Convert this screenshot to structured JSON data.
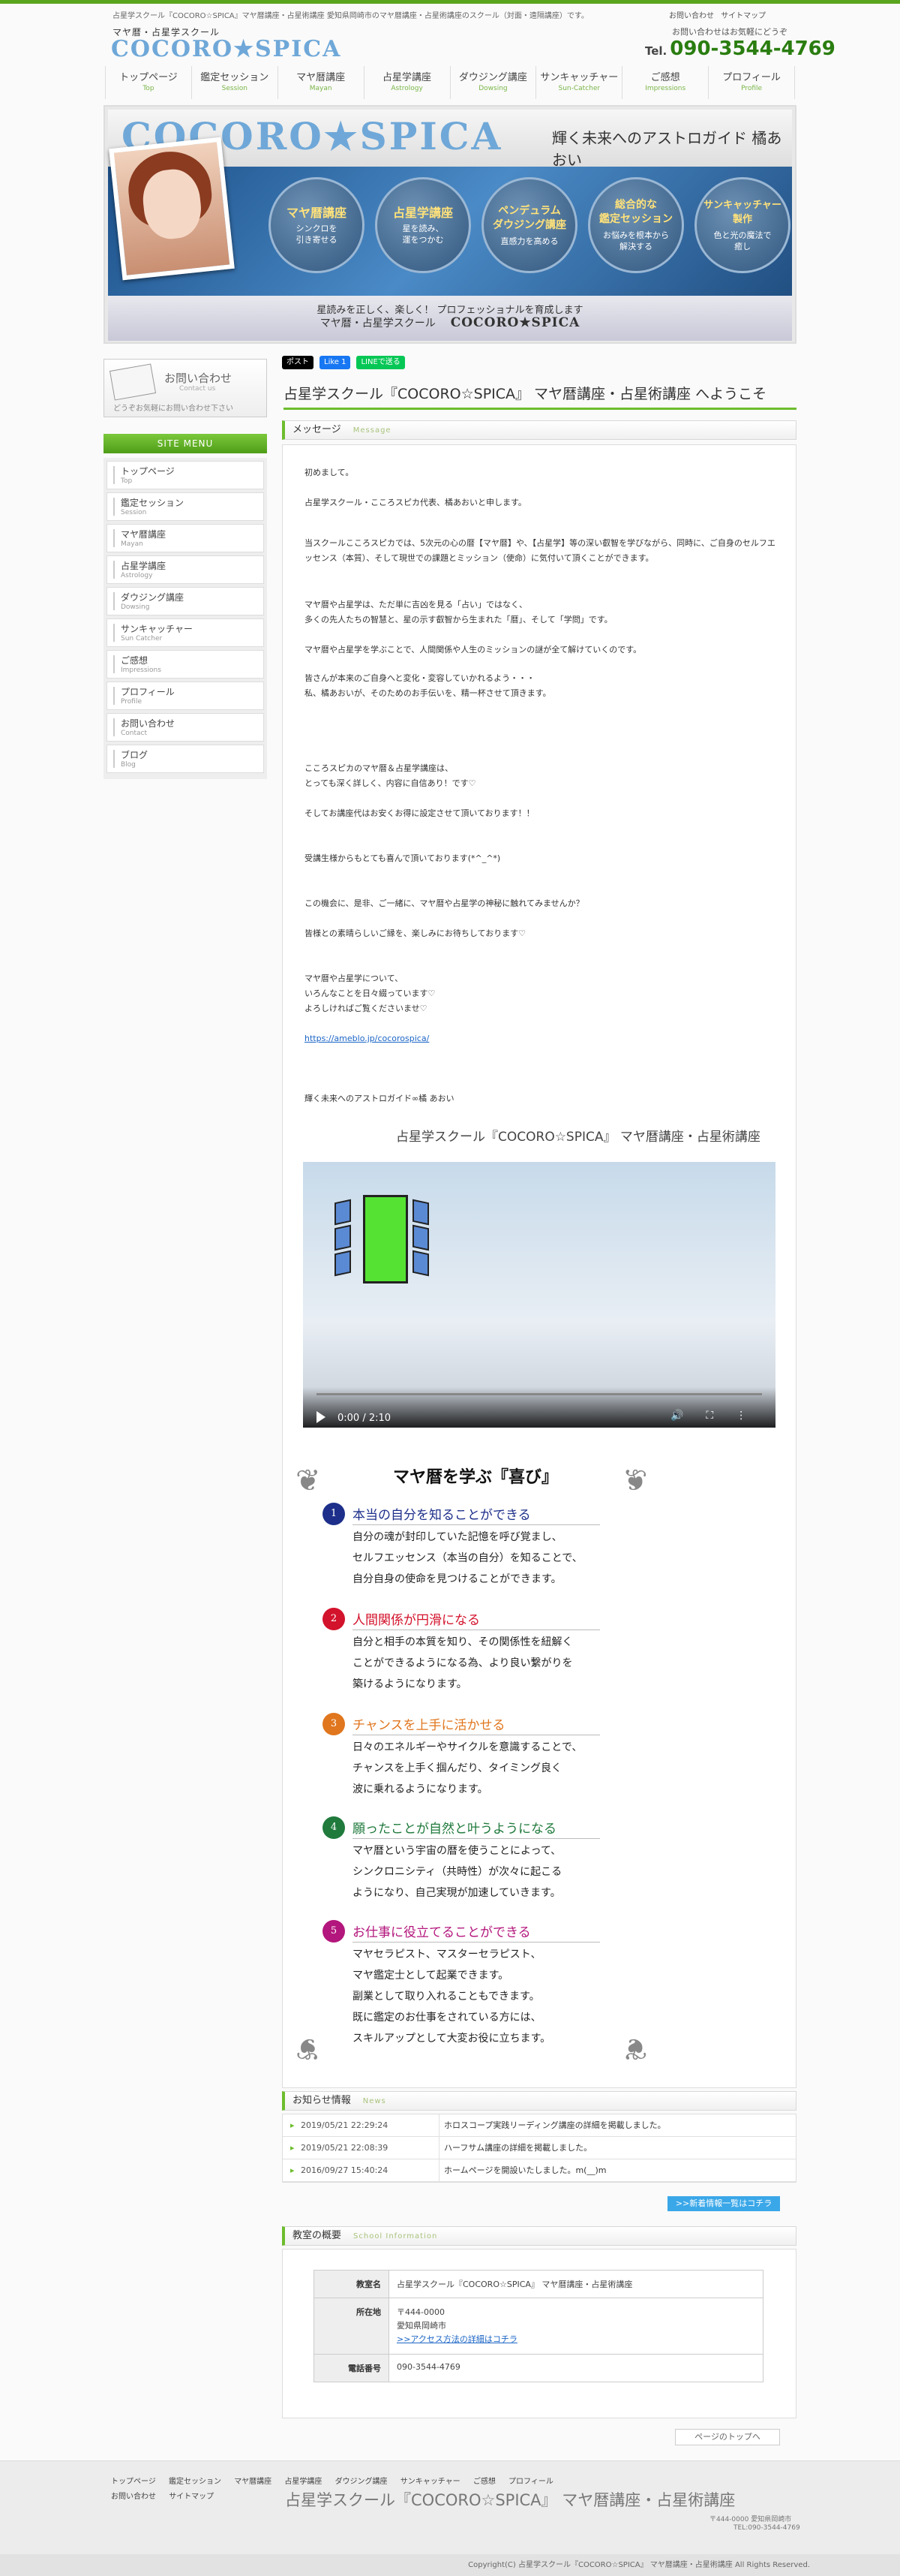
{
  "top": {
    "description": "占星学スクール『COCORO☆SPICA』マヤ暦講座・占星術講座 愛知県岡崎市のマヤ暦講座・占星術講座のスクール（対面・遠隔講座）です。",
    "links": [
      "お問い合わせ",
      "サイトマップ"
    ],
    "logo_sub": "マヤ暦・占星学スクール",
    "logo_main": "COCORO★SPICA",
    "tel_note": "お問い合わせはお気軽にどうぞ",
    "tel_prefix": "Tel.",
    "tel": "090-3544-4769"
  },
  "gnav": [
    {
      "jp": "トップページ",
      "en": "Top"
    },
    {
      "jp": "鑑定セッション",
      "en": "Session"
    },
    {
      "jp": "マヤ暦講座",
      "en": "Mayan"
    },
    {
      "jp": "占星学講座",
      "en": "Astrology"
    },
    {
      "jp": "ダウジング講座",
      "en": "Dowsing"
    },
    {
      "jp": "サンキャッチャー",
      "en": "Sun-Catcher"
    },
    {
      "jp": "ご感想",
      "en": "Impressions"
    },
    {
      "jp": "プロフィール",
      "en": "Profile"
    }
  ],
  "hero": {
    "logo": "COCORO★SPICA",
    "tagline": "輝く未来へのアストロガイド 橘あおい",
    "circles": [
      {
        "title": "マヤ暦講座",
        "sub": "シンクロを\n引き寄せる"
      },
      {
        "title": "占星学講座",
        "sub": "星を読み、\n運をつかむ"
      },
      {
        "title": "ペンデュラム\nダウジング講座",
        "sub": "直感力を高める"
      },
      {
        "title": "総合的な\n鑑定セッション",
        "sub": "お悩みを根本から\n解決する"
      },
      {
        "title": "サンキャッチャー\n製作",
        "sub": "色と光の魔法で\n癒し"
      }
    ],
    "bottom_line1": "星読みを正しく、楽しく！ プロフェッショナルを育成します",
    "bottom_line2": "マヤ暦・占星学スクール",
    "bottom_logo": "COCORO★SPICA"
  },
  "sidebar": {
    "contact_title": "お問い合わせ",
    "contact_en": "Contact us",
    "contact_note": "どうぞお気軽にお問い合わせ下さい",
    "menu_head": "SITE MENU",
    "menu": [
      {
        "jp": "トップページ",
        "en": "Top"
      },
      {
        "jp": "鑑定セッション",
        "en": "Session"
      },
      {
        "jp": "マヤ暦講座",
        "en": "Mayan"
      },
      {
        "jp": "占星学講座",
        "en": "Astrology"
      },
      {
        "jp": "ダウジング講座",
        "en": "Dowsing"
      },
      {
        "jp": "サンキャッチャー",
        "en": "Sun Catcher"
      },
      {
        "jp": "ご感想",
        "en": "Impressions"
      },
      {
        "jp": "プロフィール",
        "en": "Profile"
      },
      {
        "jp": "お問い合わせ",
        "en": "Contact"
      },
      {
        "jp": "ブログ",
        "en": "Blog"
      }
    ]
  },
  "social": {
    "tweet": "ポスト",
    "like": "Like 1",
    "line": "LINEで送る"
  },
  "page_title": "占星学スクール『COCORO☆SPICA』 マヤ暦講座・占星術講座 へようこそ",
  "message": {
    "head": "メッセージ",
    "head_en": "Message",
    "paragraphs": [
      "初めまして。",
      "占星学スクール・こころスピカ代表、橘あおいと申します。",
      "当スクールこころスピカでは、5次元の心の暦【マヤ暦】や、【占星学】等の深い叡智を学びながら、同時に、ご自身のセルフエッセンス（本質）、そして現世での課題とミッション（使命）に気付いて頂くことができます。",
      "マヤ暦や占星学は、ただ単に吉凶を見る「占い」ではなく、\n多くの先人たちの智慧と、星の示す叡智から生まれた「暦」、そして「学問」です。",
      "マヤ暦や占星学を学ぶことで、人間関係や人生のミッションの謎が全て解けていくのです。",
      "皆さんが本来のご自身へと変化・変容していかれるよう・・・\n私、橘あおいが、そのためのお手伝いを、精一杯させて頂きます。",
      "こころスピカのマヤ暦＆占星学講座は、\nとっても深く詳しく、内容に自信あり！です♡",
      "そしてお講座代はお安くお得に設定させて頂いております！！",
      "受講生様からもとても喜んで頂いております(*^_^*)",
      "この機会に、是非、ご一緒に、マヤ暦や占星学の神秘に触れてみませんか？",
      "皆様との素晴らしいご縁を、楽しみにお待ちしております♡",
      "マヤ暦や占星学について、\nいろんなことを日々綴っています♡\nよろしければご覧くださいませ♡",
      "https://ameblo.jp/cocorospica/",
      "輝く未来へのアストロガイド∞橘 あおい"
    ],
    "school_name": "占星学スクール『COCORO☆SPICA』 マヤ暦講座・占星術講座"
  },
  "video": {
    "time": "0:00 / 2:10"
  },
  "joy": {
    "title": "マヤ暦を学ぶ『喜び』",
    "items": [
      {
        "num": "1",
        "head": "本当の自分を知ることができる",
        "color": "#1d2f8a",
        "body": "自分の魂が封印していた記憶を呼び覚まし、\nセルフエッセンス（本当の自分）を知ることで、\n自分自身の使命を見つけることができます。"
      },
      {
        "num": "2",
        "head": "人間関係が円滑になる",
        "color": "#d3122b",
        "body": "自分と相手の本質を知り、その関係性を紐解く\nことができるようになる為、より良い繋がりを\n築けるようになります。"
      },
      {
        "num": "3",
        "head": "チャンスを上手に活かせる",
        "color": "#e0761e",
        "body": "日々のエネルギーやサイクルを意識することで、\nチャンスを上手く掴んだり、タイミング良く\n波に乗れるようになります。"
      },
      {
        "num": "4",
        "head": "願ったことが自然と叶うようになる",
        "color": "#1f7a3c",
        "body": "マヤ暦という宇宙の暦を使うことによって、\nシンクロニシティ（共時性）が次々に起こる\nようになり、自己実現が加速していきます。"
      },
      {
        "num": "5",
        "head": "お仕事に役立てることができる",
        "color": "#b3167c",
        "body": "マヤセラピスト、マスターセラピスト、\nマヤ鑑定士として起業できます。\n副業として取り入れることもできます。\n既に鑑定のお仕事をされている方には、\nスキルアップとして大変お役に立ちます。"
      }
    ]
  },
  "news": {
    "head": "お知らせ情報",
    "head_en": "News",
    "rows": [
      {
        "date": "2019/05/21 22:29:24",
        "title": "ホロスコープ実践リーディング講座の詳細を掲載しました。"
      },
      {
        "date": "2019/05/21 22:08:39",
        "title": "ハーフサム講座の詳細を掲載しました。"
      },
      {
        "date": "2016/09/27 15:40:24",
        "title": "ホームページを開設いたしました。m(__)m"
      }
    ],
    "more": ">>新着情報一覧はコチラ"
  },
  "school": {
    "head": "教室の概要",
    "head_en": "School Information",
    "rows": [
      {
        "key": "教室名",
        "value": "占星学スクール『COCORO☆SPICA』 マヤ暦講座・占星術講座"
      },
      {
        "key": "所在地",
        "value": "〒444-0000\n愛知県岡崎市",
        "link": ">>アクセス方法の詳細はコチラ"
      },
      {
        "key": "電話番号",
        "value": "090-3544-4769"
      }
    ]
  },
  "pagetop": "ページのトップへ",
  "footer": {
    "nav1": [
      "トップページ",
      "鑑定セッション",
      "マヤ暦講座",
      "占星学講座",
      "ダウジング講座",
      "サンキャッチャー",
      "ご感想",
      "プロフィール"
    ],
    "nav2": [
      "お問い合わせ",
      "サイトマップ"
    ],
    "name": "占星学スクール『COCORO☆SPICA』 マヤ暦講座・占星術講座",
    "addr1": "〒444-0000 愛知県岡崎市",
    "addr2": "TEL:090-3544-4769",
    "copyright": "Copyright(C) 占星学スクール『COCORO☆SPICA』 マヤ暦講座・占星術講座 All Rights Reserved."
  }
}
